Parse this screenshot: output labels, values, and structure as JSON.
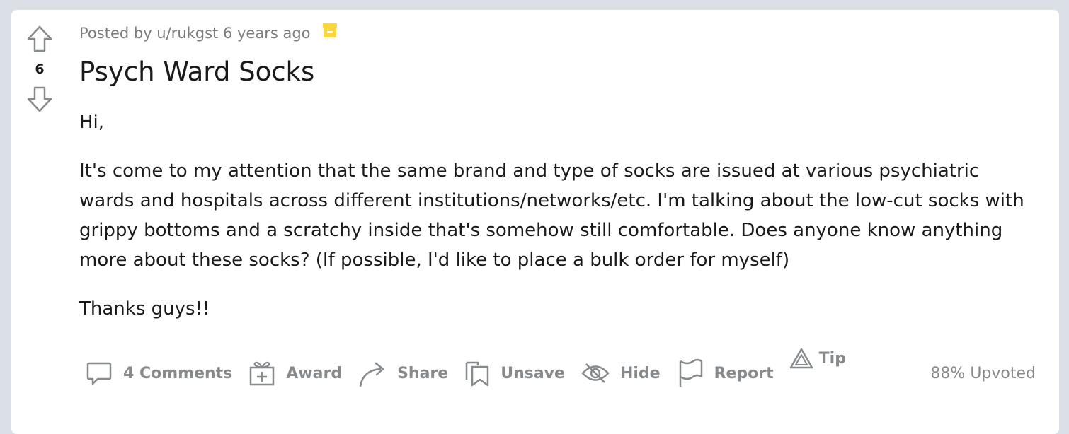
{
  "post": {
    "votes": "6",
    "meta": {
      "posted_by": "Posted by u/rukgst 6 years ago",
      "archive_icon": "archive-box-icon"
    },
    "title": "Psych Ward Socks",
    "body": [
      "Hi,",
      "It's come to my attention that the same brand and type of socks are issued at various psychiatric wards and hospitals across different institutions/networks/etc. I'm talking about the low-cut socks with grippy bottoms and a scratchy inside that's somehow still comfortable. Does anyone know anything more about these socks? (If possible, I'd like to place a bulk order for myself)",
      "Thanks guys!!"
    ]
  },
  "actions": {
    "comments": "4 Comments",
    "award": "Award",
    "share": "Share",
    "unsave": "Unsave",
    "hide": "Hide",
    "report": "Report",
    "tip": "Tip",
    "upvoted": "88% Upvoted"
  },
  "colors": {
    "background": "#dae0e6",
    "card": "#ffffff",
    "text": "#1a1a1b",
    "muted": "#878a8c",
    "archive": "#ffd635"
  }
}
